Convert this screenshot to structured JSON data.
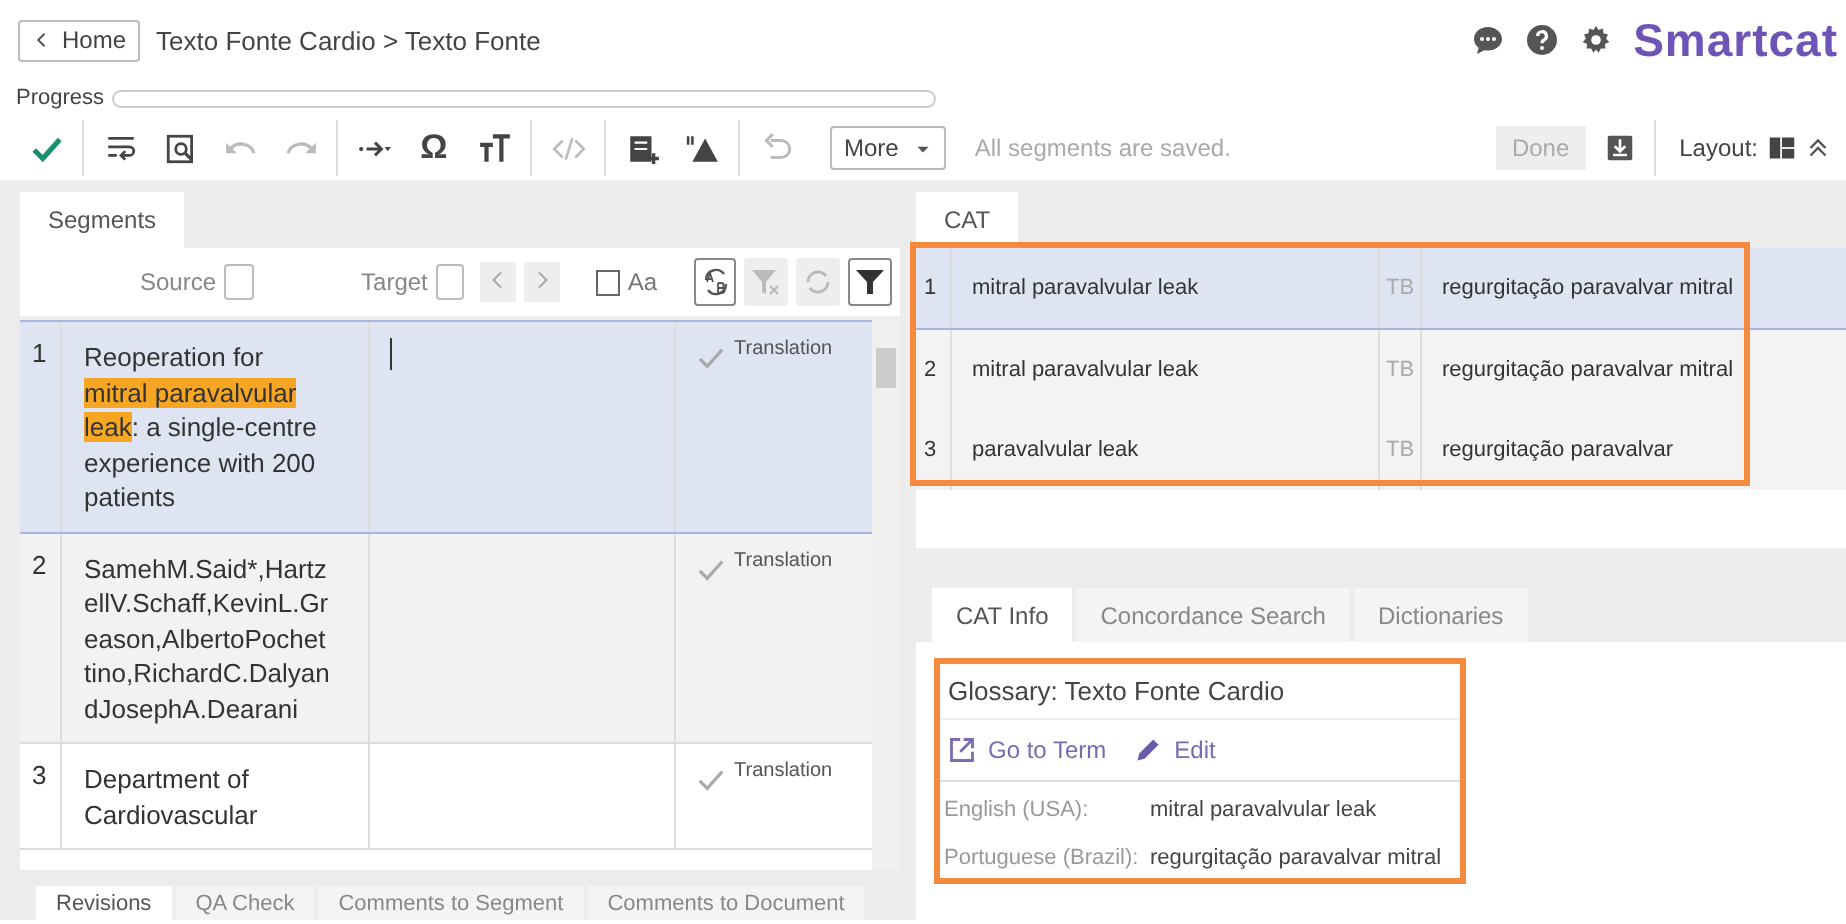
{
  "header": {
    "home_button": "Home",
    "breadcrumb": "Texto Fonte Cardio > Texto Fonte",
    "logo": "Smartcat"
  },
  "progress": {
    "label": "Progress",
    "level": 0
  },
  "toolbar": {
    "items": [
      {
        "kind": "confirm",
        "disabled": false
      },
      {
        "kind": "sep"
      },
      {
        "kind": "wrap",
        "disabled": false
      },
      {
        "kind": "find",
        "disabled": false
      },
      {
        "kind": "undo",
        "disabled": true
      },
      {
        "kind": "redo",
        "disabled": true
      },
      {
        "kind": "sep"
      },
      {
        "kind": "arrow",
        "disabled": false
      },
      {
        "kind": "char",
        "glyph": "Ω",
        "disabled": false
      },
      {
        "kind": "case",
        "disabled": false
      },
      {
        "kind": "sep"
      },
      {
        "kind": "tags",
        "disabled": true
      },
      {
        "kind": "sep"
      },
      {
        "kind": "note",
        "disabled": false
      },
      {
        "kind": "qa",
        "disabled": false
      },
      {
        "kind": "sep"
      },
      {
        "kind": "revert",
        "disabled": true
      }
    ],
    "more": "More",
    "status": "All segments are saved.",
    "done": "Done",
    "layout": "Layout:"
  },
  "segments_panel": {
    "tab": "Segments",
    "filter": {
      "source": "Source",
      "target": "Target",
      "match_case": {
        "label": "Aa",
        "checked": false
      }
    },
    "rows": [
      {
        "number": "1",
        "selected": true,
        "editing": true,
        "source": [
          {
            "text": "Reoperation for ",
            "highlighted": false
          },
          {
            "text": "mitral ",
            "highlighted": true
          },
          {
            "text": "paravalvular ",
            "highlighted": true
          },
          {
            "text": "leak",
            "highlighted": true
          },
          {
            "text": ": a single-centre experience with 200 patients",
            "highlighted": false
          }
        ],
        "status": "Translation"
      },
      {
        "number": "2",
        "selected": false,
        "editing": false,
        "source": [
          {
            "text": "SamehM.Said*,HartzellV.Schaff,KevinL.Greason,AlbertoPochettino,RichardC.DalyandJosephA.Dearani",
            "highlighted": false
          }
        ],
        "status": "Translation"
      },
      {
        "number": "3",
        "selected": false,
        "editing": false,
        "source": [
          {
            "text": "Department of Cardiovascular",
            "highlighted": false
          }
        ],
        "status": "Translation"
      }
    ],
    "bottom_tabs": [
      {
        "label": "Revisions",
        "selected": true
      },
      {
        "label": "QA Check",
        "selected": false
      },
      {
        "label": "Comments to Segment",
        "selected": false
      },
      {
        "label": "Comments to Document",
        "selected": false
      }
    ]
  },
  "cat_panel": {
    "tab": "CAT",
    "results": [
      {
        "number": "1",
        "source": "mitral paravalvular leak",
        "type": "TB",
        "target": "regurgitação paravalvar mitral",
        "selected": true
      },
      {
        "number": "2",
        "source": "mitral paravalvular leak",
        "type": "TB",
        "target": "regurgitação paravalvar mitral",
        "selected": false
      },
      {
        "number": "3",
        "source": "paravalvular leak",
        "type": "TB",
        "target": "regurgitação paravalvar",
        "selected": false
      }
    ],
    "info_tabs": [
      {
        "label": "CAT Info",
        "selected": true
      },
      {
        "label": "Concordance Search",
        "selected": false
      },
      {
        "label": "Dictionaries",
        "selected": false
      }
    ],
    "glossary": {
      "title": "Glossary: Texto Fonte Cardio",
      "go_to_term": "Go to Term",
      "edit": "Edit",
      "terms": [
        {
          "language": "English (USA):",
          "term": "mitral paravalvular leak"
        },
        {
          "language": "Portuguese (Brazil):",
          "term": "regurgitação paravalvar mitral"
        }
      ]
    }
  }
}
